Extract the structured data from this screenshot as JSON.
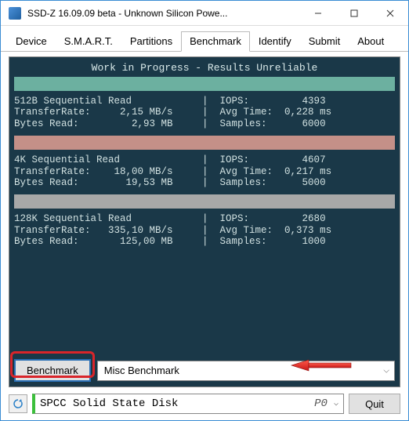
{
  "window": {
    "title": "SSD-Z 16.09.09 beta - Unknown Silicon Powe..."
  },
  "tabs": [
    "Device",
    "S.M.A.R.T.",
    "Partitions",
    "Benchmark",
    "Identify",
    "Submit",
    "About"
  ],
  "active_tab": 3,
  "bench": {
    "wip": "Work in Progress - Results Unreliable",
    "tests": [
      {
        "name": "512B Sequential Read",
        "rate": "2,15 MB/s",
        "bytes": "2,93 MB",
        "iops": "4393",
        "avg": "0,228 ms",
        "samples": "6000",
        "barclass": "bar1"
      },
      {
        "name": "4K Sequential Read",
        "rate": "18,00 MB/s",
        "bytes": "19,53 MB",
        "iops": "4607",
        "avg": "0,217 ms",
        "samples": "5000",
        "barclass": "bar2"
      },
      {
        "name": "128K Sequential Read",
        "rate": "335,10 MB/s",
        "bytes": "125,00 MB",
        "iops": "2680",
        "avg": "0,373 ms",
        "samples": "1000",
        "barclass": "bar3"
      }
    ],
    "button": "Benchmark",
    "dropdown": "Misc Benchmark"
  },
  "footer": {
    "disk": "SPCC Solid State Disk",
    "port": "P0",
    "quit": "Quit"
  }
}
